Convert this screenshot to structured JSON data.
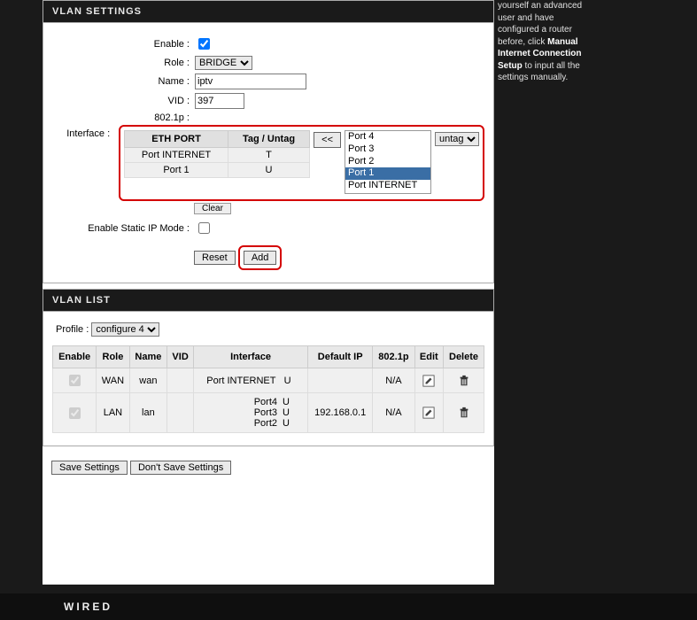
{
  "help": {
    "line1": "yourself an advanced user and have configured a router before, click ",
    "bold": "Manual Internet Connection Setup",
    "line2": " to input all the settings manually."
  },
  "vlan_settings": {
    "header": "VLAN SETTINGS",
    "enable_label": "Enable :",
    "enable_checked": true,
    "role_label": "Role :",
    "role_value": "BRIDGE",
    "name_label": "Name :",
    "name_value": "iptv",
    "vid_label": "VID :",
    "vid_value": "397",
    "p1p_label": "802.1p :",
    "interface_label": "Interface :",
    "eth_port_hdr": "ETH PORT",
    "tag_hdr": "Tag / Untag",
    "rows": [
      {
        "port": "Port INTERNET",
        "tag": "T"
      },
      {
        "port": "Port 1",
        "tag": "U"
      }
    ],
    "move_btn": "<<",
    "port_options": [
      "Port 4",
      "Port 3",
      "Port 2",
      "Port 1",
      "Port INTERNET"
    ],
    "port_selected": "Port 1",
    "untag_value": "untag",
    "clear_btn": "Clear",
    "static_ip_label": "Enable Static IP Mode :",
    "reset_btn": "Reset",
    "add_btn": "Add"
  },
  "vlan_list": {
    "header": "VLAN LIST",
    "profile_label": "Profile :",
    "profile_value": "configure 4",
    "cols": {
      "enable": "Enable",
      "role": "Role",
      "name": "Name",
      "vid": "VID",
      "interface": "Interface",
      "default_ip": "Default IP",
      "p8021p": "802.1p",
      "edit": "Edit",
      "delete": "Delete"
    },
    "rows": [
      {
        "enable": true,
        "role": "WAN",
        "name": "wan",
        "vid": "",
        "interfaces": [
          {
            "port": "Port INTERNET",
            "tag": "U"
          }
        ],
        "default_ip": "",
        "p8021p": "N/A"
      },
      {
        "enable": true,
        "role": "LAN",
        "name": "lan",
        "vid": "",
        "interfaces": [
          {
            "port": "Port4",
            "tag": "U"
          },
          {
            "port": "Port3",
            "tag": "U"
          },
          {
            "port": "Port2",
            "tag": "U"
          }
        ],
        "default_ip": "192.168.0.1",
        "p8021p": "N/A"
      }
    ]
  },
  "save_btn": "Save Settings",
  "dont_save_btn": "Don't Save Settings",
  "footer": "WIRED"
}
